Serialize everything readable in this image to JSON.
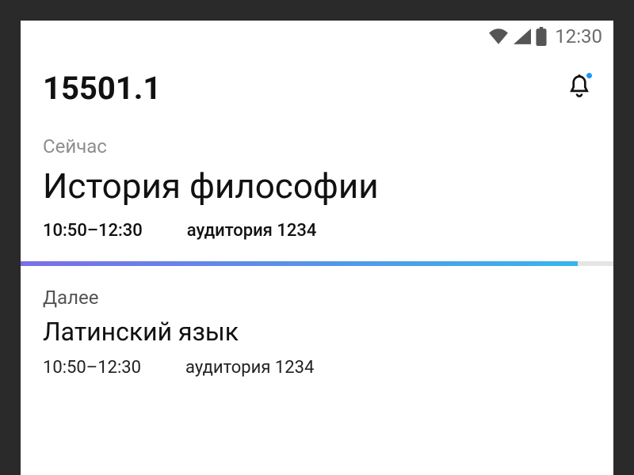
{
  "status_bar": {
    "time": "12:30"
  },
  "header": {
    "title": "15501.1"
  },
  "current": {
    "label": "Сейчас",
    "course": "История философии",
    "time": "10:50–12:30",
    "room": "аудитория 1234"
  },
  "next": {
    "label": "Далее",
    "course": "Латинский язык",
    "time": "10:50–12:30",
    "room": "аудитория 1234"
  }
}
